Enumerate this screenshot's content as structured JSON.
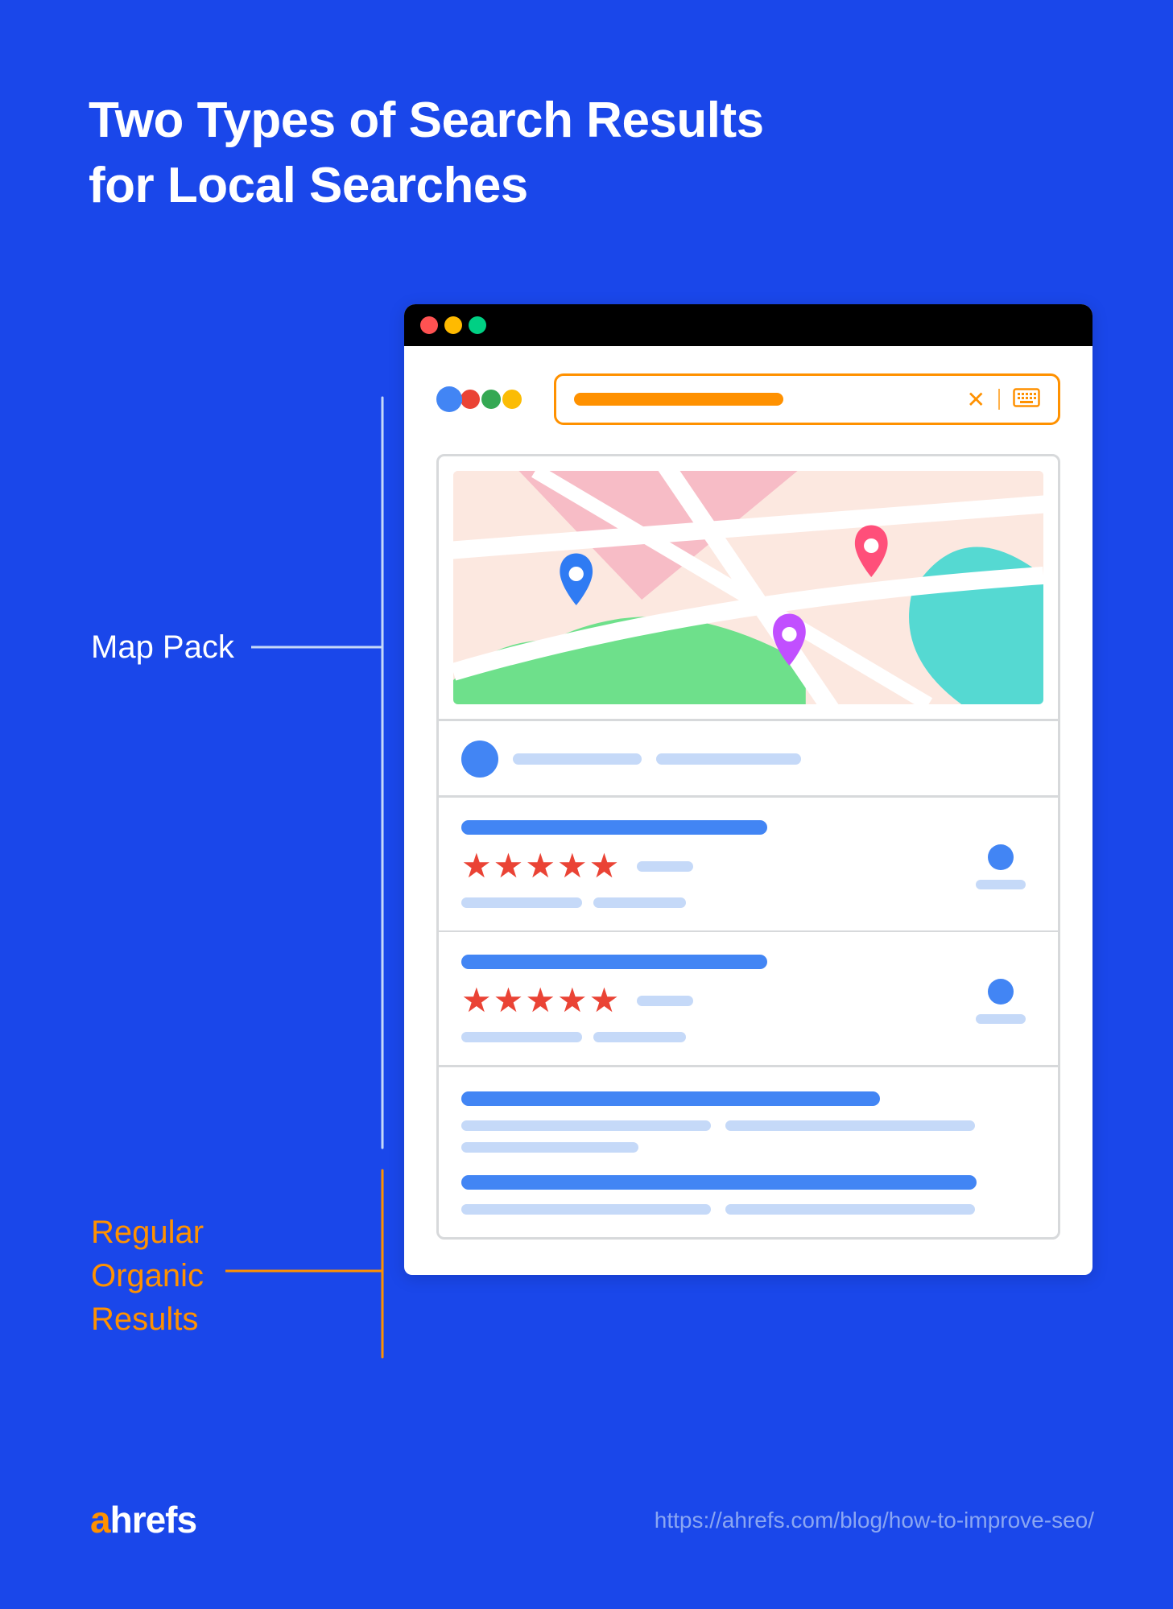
{
  "title": "Two Types of Search Results\nfor Local Searches",
  "labels": {
    "map_pack": "Map Pack",
    "organic": "Regular\nOrganic\nResults"
  },
  "logo": {
    "prefix": "a",
    "rest": "hrefs"
  },
  "footer_url": "https://ahrefs.com/blog/how-to-improve-seo/",
  "colors": {
    "accent_blue": "#1a47ea",
    "orange": "#ff9100",
    "google_blue": "#4285f4",
    "star_red": "#ea4335"
  }
}
